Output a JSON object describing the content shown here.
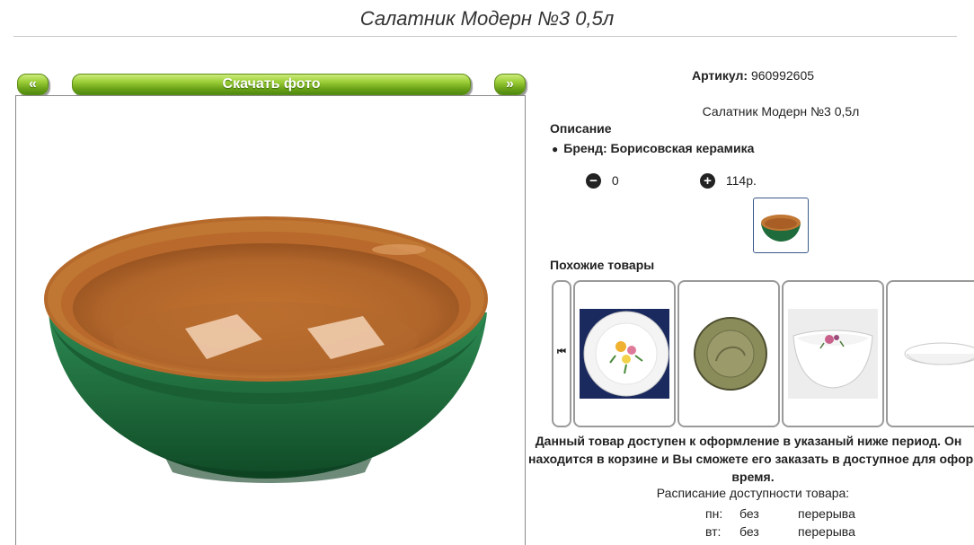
{
  "page": {
    "title": "Салатник Модерн №3 0,5л"
  },
  "photo_nav": {
    "prev": "«",
    "download": "Скачать фото",
    "next": "»"
  },
  "product": {
    "article_label": "Артикул:",
    "article_value": "960992605",
    "name": "Салатник Модерн №3 0,5л",
    "description_heading": "Описание",
    "brand": "Бренд: Борисовская керамика",
    "quantity": "0",
    "price": "114р."
  },
  "similar": {
    "heading": "Похожие товары",
    "items": [
      {
        "icon": "flower-plate-image"
      },
      {
        "icon": "smoky-glass-plate-image"
      },
      {
        "icon": "floral-square-bowl-image"
      },
      {
        "icon": "white-dish-image"
      }
    ]
  },
  "availability": {
    "line1": "Данный товар доступен к оформление в указаный ниже период. Он",
    "line2": "находится в корзине и Вы сможете его заказать в доступное для оформ",
    "line3": "время.",
    "schedule_title": "Расписание доступности товара:",
    "rows": [
      {
        "day": "пн:",
        "from": "без",
        "to": "перерыва"
      },
      {
        "day": "вт:",
        "from": "без",
        "to": "перерыва"
      }
    ]
  },
  "colors": {
    "accent_green": "#6ea51a",
    "bowl_green": "#1f6b3c",
    "bowl_terracotta": "#b5672a"
  }
}
